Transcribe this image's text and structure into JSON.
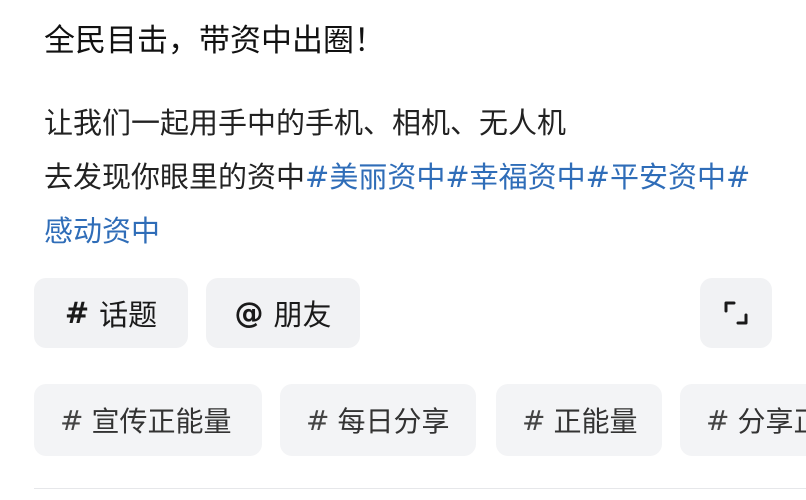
{
  "post": {
    "title": "全民目击，带资中出圈！",
    "body_line1": "让我们一起用手中的手机、相机、无人机",
    "body_line2_prefix": "去发现你眼里的资中",
    "hashtags": [
      "#美丽资中",
      "#幸福资中",
      "#平安资中",
      "#感动资中"
    ]
  },
  "toolbar": {
    "topic_symbol": "#",
    "topic_label": "话题",
    "friend_symbol": "@",
    "friend_label": "朋友"
  },
  "suggested_tags": [
    {
      "hash": "#",
      "label": "宣传正能量"
    },
    {
      "hash": "#",
      "label": "每日分享"
    },
    {
      "hash": "#",
      "label": "正能量"
    },
    {
      "hash": "#",
      "label": "分享正"
    }
  ],
  "colors": {
    "link": "#2f6db8",
    "chip_bg": "#f1f2f4"
  }
}
